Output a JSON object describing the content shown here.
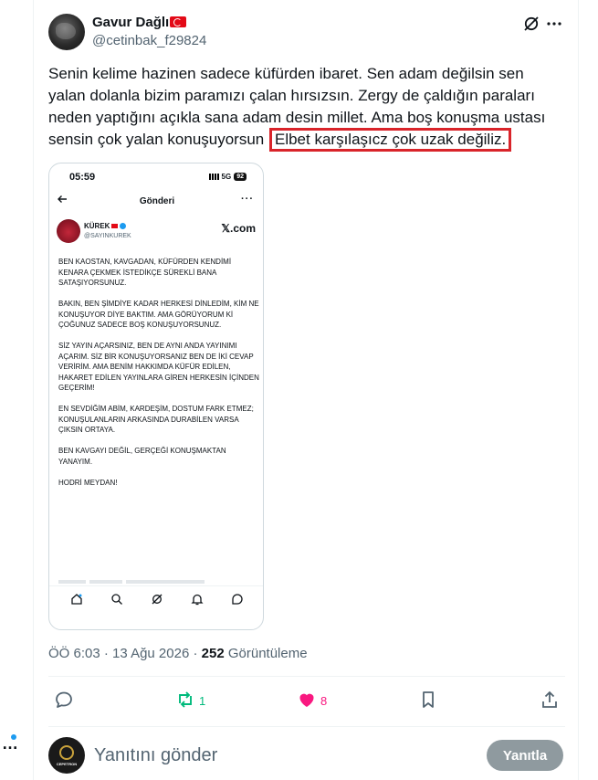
{
  "author": {
    "name": "Gavur Dağlı",
    "handle": "@cetinbak_f29824"
  },
  "tweet": {
    "text": "Senin kelime hazinen sadece küfürden ibaret. Sen adam değilsin sen yalan dolanla bizim paramızı çalan hırsızsın. Zergy de çaldığın paraları neden yaptığını açıkla sana adam desin millet. Ama boş konuşma ustası sensin çok yalan konuşuyorsun",
    "highlighted": "Elbet karşılaşıcz çok uzak değiliz.",
    "highlight_color": "#d9242a"
  },
  "embedded": {
    "time": "05:59",
    "network": "5G",
    "battery": "92",
    "title": "Gönderi",
    "name": "KÜREK",
    "handle": "@SAYINKUREK",
    "logo": "𝕏.com",
    "paragraphs": [
      "BEN KAOSTAN, KAVGADAN, KÜFÜRDEN KENDİMİ KENARA ÇEKMEK İSTEDİKÇE SÜREKLİ BANA SATAŞIYORSUNUZ.",
      "BAKIN, BEN ŞİMDİYE KADAR HERKESİ DİNLEDİM, KİM NE KONUŞUYOR DİYE BAKTIM. AMA GÖRÜYORUM Kİ ÇOĞUNUZ SADECE BOŞ KONUŞUYORSUNUZ.",
      "SİZ YAYIN AÇARSINIZ, BEN DE AYNI ANDA YAYINIMI AÇARIM. SİZ BİR KONUŞUYORSANIZ BEN DE İKİ CEVAP VERİRİM. AMA BENİM HAKKIMDA KÜFÜR EDİLEN, HAKARET EDİLEN YAYINLARA GİREN HERKESİN İÇİNDEN GEÇERİM!",
      "EN SEVDİĞİM ABİM, KARDEŞİM, DOSTUM FARK ETMEZ; KONUŞULANLARIN ARKASINDA DURABİLEN VARSA ÇIKSIN ORTAYA.",
      "BEN KAVGAYI DEĞİL, GERÇEĞİ KONUŞMAKTAN YANAYIM.",
      "HODRİ MEYDAN!"
    ]
  },
  "meta": {
    "time": "ÖÖ 6:03",
    "separator": "·",
    "date": "13 Ağu 2026",
    "views": "252",
    "views_label": "Görüntüleme"
  },
  "stats": {
    "retweets": "1",
    "likes": "8"
  },
  "colors": {
    "retweet": "#00ba7c",
    "like": "#f91880",
    "secondary": "#536471"
  },
  "reply": {
    "placeholder": "Yanıtını gönder",
    "button": "Yanıtla",
    "avatar_text": "CEPETRON"
  }
}
